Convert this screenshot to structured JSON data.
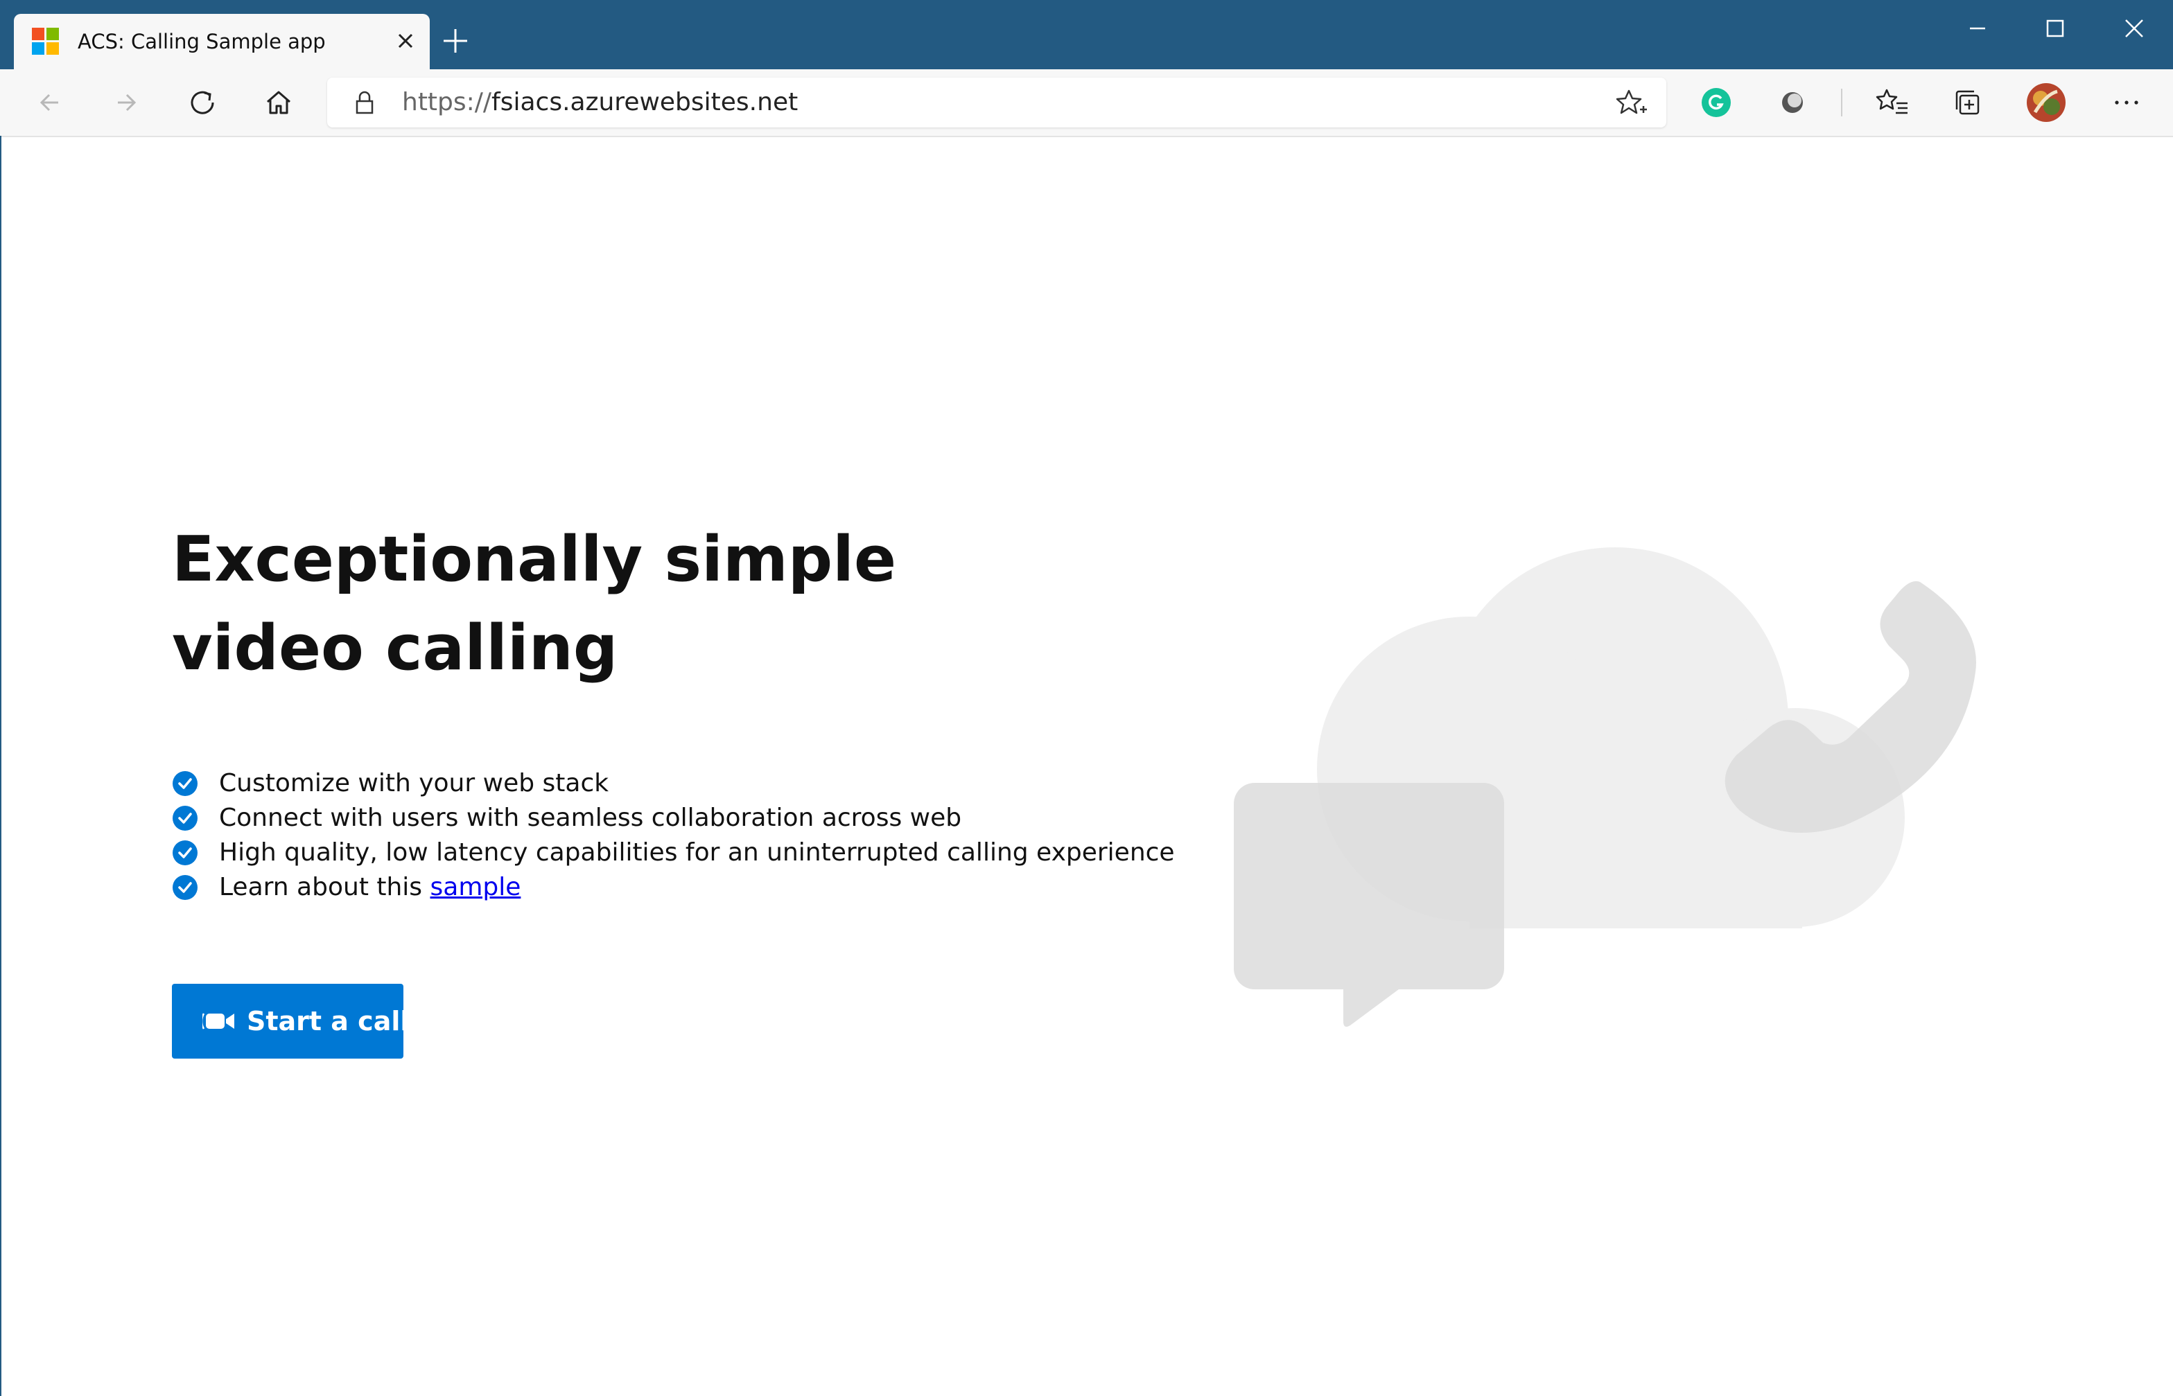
{
  "browser": {
    "tab_title": "ACS: Calling Sample app",
    "url_scheme": "https://",
    "url_host": "fsiacs.azurewebsites.net",
    "icons": {
      "favicon": "microsoft-logo-icon",
      "tab_close": "close-icon",
      "new_tab": "plus-icon",
      "minimize": "minimize-icon",
      "maximize": "maximize-icon",
      "close": "close-icon",
      "back": "arrow-left-icon",
      "forward": "arrow-right-icon",
      "refresh": "refresh-icon",
      "home": "home-icon",
      "lock": "lock-icon",
      "favorite": "star-add-icon",
      "grammarly": "grammarly-icon",
      "extension": "extension-icon",
      "favorites": "favorites-icon",
      "collections": "collections-icon",
      "profile": "avatar",
      "more": "more-icon"
    },
    "colors": {
      "titlebar": "#235a82",
      "toolbar": "#f7f7f7"
    }
  },
  "page": {
    "headline_line1": "Exceptionally simple",
    "headline_line2": "video calling",
    "features": [
      "Customize with your web stack",
      "Connect with users with seamless collaboration across web",
      "High quality, low latency capabilities for an uninterrupted calling experience"
    ],
    "learn_prefix": "Learn about this ",
    "learn_link": "sample",
    "start_button": "Start a call",
    "accent_color": "#0078d4",
    "illustration": "cloud-chat-phone-illustration"
  }
}
